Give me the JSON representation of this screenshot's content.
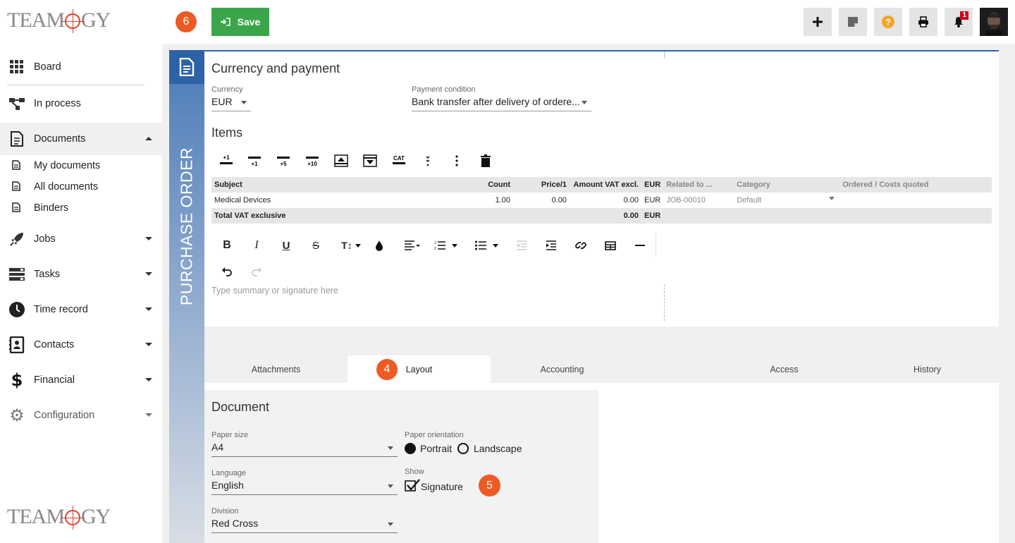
{
  "app": {
    "logo_text": "TEAMOGY"
  },
  "badges": {
    "top": "6",
    "tab": "4",
    "signature": "5"
  },
  "toolbar": {
    "save_label": "Save",
    "buttons": [
      "plus-icon",
      "note-icon",
      "help-icon",
      "print-icon",
      "bell-icon"
    ],
    "notification_count": "1",
    "colors": {
      "save": "#3aa54a",
      "help": "#f5a623",
      "badge": "#ee5a24"
    }
  },
  "sidebar": {
    "items": [
      {
        "label": "Board",
        "icon": "grid-icon"
      },
      {
        "label": "In process",
        "icon": "flow-icon"
      },
      {
        "label": "Documents",
        "icon": "document-icon"
      },
      {
        "label": "Jobs",
        "icon": "rocket-icon"
      },
      {
        "label": "Tasks",
        "icon": "tasks-icon"
      },
      {
        "label": "Time record",
        "icon": "clock-icon"
      },
      {
        "label": "Contacts",
        "icon": "contacts-icon"
      },
      {
        "label": "Financial",
        "icon": "dollar-icon"
      },
      {
        "label": "Configuration",
        "icon": "gear-icon"
      }
    ],
    "subitems": [
      {
        "label": "My documents"
      },
      {
        "label": "All documents"
      },
      {
        "label": "Binders"
      }
    ]
  },
  "document": {
    "type_label": "PURCHASE ORDER"
  },
  "currency_section": {
    "title": "Currency and payment",
    "currency": {
      "label": "Currency",
      "value": "EUR"
    },
    "payment": {
      "label": "Payment condition",
      "value": "Bank transfer after delivery of ordere..."
    }
  },
  "items": {
    "title": "Items",
    "tool_labels": {
      "plus1": "+1",
      "plus5": "+5",
      "plus10": "+10",
      "cat": "CAT"
    },
    "headers": {
      "subject": "Subject",
      "count": "Count",
      "price": "Price/1",
      "amount": "Amount VAT excl.",
      "currency": "EUR",
      "related": "Related to ...",
      "category": "Category",
      "ordered": "Ordered / Costs quoted"
    },
    "rows": [
      {
        "subject": "Medical Devices",
        "count": "1.00",
        "price": "0.00",
        "amount": "0.00",
        "currency": "EUR",
        "related": "JOB-00010",
        "category": "Default"
      }
    ],
    "total": {
      "label": "Total VAT exclusive",
      "amount": "0.00",
      "currency": "EUR"
    }
  },
  "editor": {
    "placeholder": "Type summary or signature here"
  },
  "tabs": [
    {
      "label": "Attachments"
    },
    {
      "label": "Layout",
      "active": true
    },
    {
      "label": "Accounting"
    },
    {
      "label": ""
    },
    {
      "label": "Access"
    },
    {
      "label": "History"
    }
  ],
  "layout": {
    "title": "Document",
    "paper_size": {
      "label": "Paper size",
      "value": "A4"
    },
    "language": {
      "label": "Language",
      "value": "English"
    },
    "division": {
      "label": "Division",
      "value": "Red Cross"
    },
    "orientation": {
      "label": "Paper orientation",
      "portrait": "Portrait",
      "landscape": "Landscape",
      "selected": "Portrait"
    },
    "show": {
      "label": "Show",
      "signature": "Signature",
      "checked": true
    }
  }
}
